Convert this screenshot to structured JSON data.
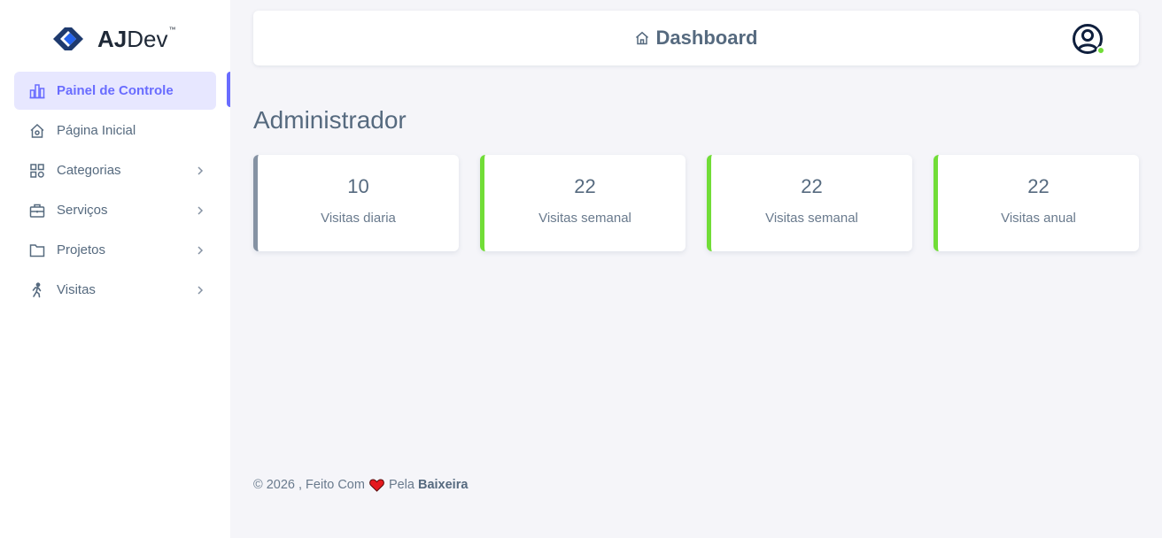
{
  "brand": {
    "name_bold": "AJ",
    "name_light": "Dev",
    "tm": "™"
  },
  "sidebar": {
    "items": [
      {
        "label": "Painel de Controle",
        "icon": "bar-chart-icon",
        "active": true,
        "submenu": false
      },
      {
        "label": "Página Inicial",
        "icon": "home-icon",
        "active": false,
        "submenu": false
      },
      {
        "label": "Categorias",
        "icon": "grid-icon",
        "active": false,
        "submenu": true
      },
      {
        "label": "Serviços",
        "icon": "briefcase-icon",
        "active": false,
        "submenu": true
      },
      {
        "label": "Projetos",
        "icon": "folder-icon",
        "active": false,
        "submenu": true
      },
      {
        "label": "Visitas",
        "icon": "walking-icon",
        "active": false,
        "submenu": true
      }
    ]
  },
  "navbar": {
    "title": "Dashboard",
    "title_icon": "home-icon",
    "avatar_icon": "user-circle-icon",
    "status_color": "#71dd37"
  },
  "main": {
    "heading": "Administrador",
    "cards": [
      {
        "value": "10",
        "label": "Visitas diaria",
        "accent": "#8592a3"
      },
      {
        "value": "22",
        "label": "Visitas semanal",
        "accent": "#71dd37"
      },
      {
        "value": "22",
        "label": "Visitas semanal",
        "accent": "#71dd37"
      },
      {
        "value": "22",
        "label": "Visitas anual",
        "accent": "#71dd37"
      }
    ]
  },
  "footer": {
    "prefix": "© 2026 , Feito Com",
    "middle": "Pela",
    "author": "Baixeira",
    "heart_icon": "heart-icon"
  },
  "colors": {
    "primary": "#696cff",
    "active_bg": "#e7e7ff",
    "background": "#f5f5f9",
    "text": "#566a7f"
  }
}
